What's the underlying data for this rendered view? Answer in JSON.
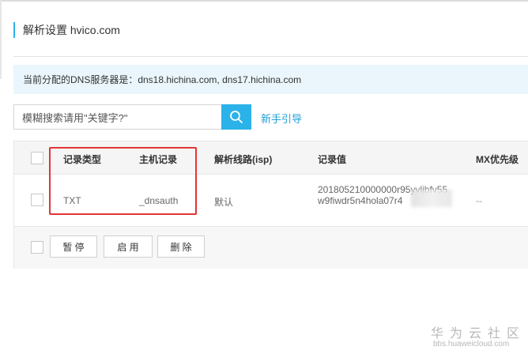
{
  "header": {
    "title": "解析设置 hvico.com"
  },
  "notice": {
    "text": "当前分配的DNS服务器是：dns18.hichina.com, dns17.hichina.com"
  },
  "search": {
    "placeholder": "模糊搜索请用\"关键字?\"",
    "guide_link": "新手引导"
  },
  "table": {
    "columns": {
      "record_type": "记录类型",
      "host": "主机记录",
      "isp_line": "解析线路(isp)",
      "value": "记录值",
      "mx_priority": "MX优先级"
    },
    "rows": [
      {
        "record_type": "TXT",
        "host": "_dnsauth",
        "isp_line": "默认",
        "value_line1": "201805210000000r95yvljbfv55",
        "value_line2": "w9fiwdr5n4hola07r4",
        "mx_priority": "--"
      }
    ]
  },
  "actions": {
    "pause": "暂 停",
    "enable": "启 用",
    "delete": "删 除"
  },
  "watermark": {
    "site_name": "华为云社区",
    "url": "bbs.huaweicloud.com"
  },
  "colors": {
    "accent": "#2bb2e8",
    "highlight": "#e03535",
    "link": "#1fa0d8"
  }
}
